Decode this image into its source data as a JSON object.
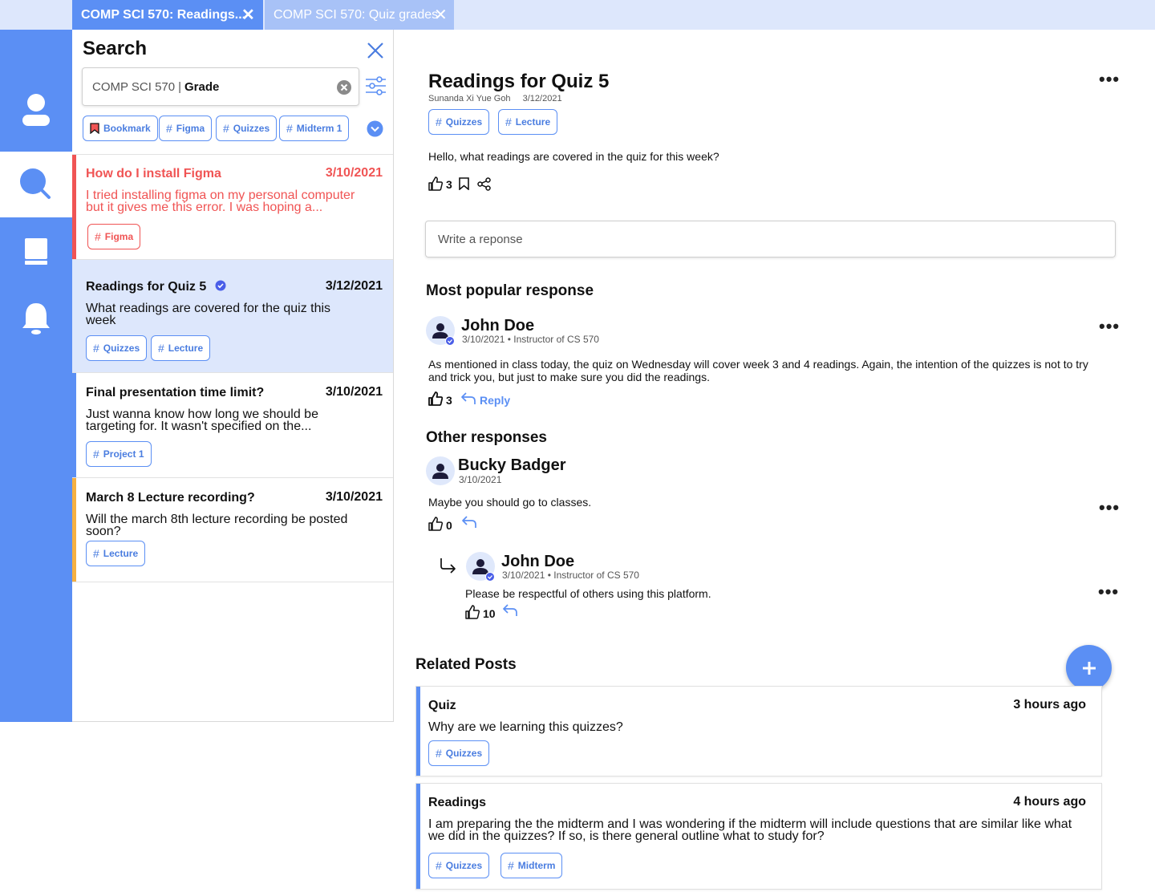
{
  "tabs": [
    {
      "label": "COMP SCI 570: Readings..."
    },
    {
      "label": "COMP SCI 570: Quiz grades"
    }
  ],
  "search": {
    "title": "Search",
    "query_prefix": "COMP SCI 570",
    "query_sep": "|",
    "query_term": "Grade",
    "filters": [
      "Bookmark",
      "Figma",
      "Quizzes",
      "Midterm 1"
    ]
  },
  "posts": [
    {
      "title": "How do I install Figma",
      "date": "3/10/2021",
      "body": "I tried installing figma on my personal computer but it gives me this error. I was hoping a...",
      "tags": [
        "Figma"
      ],
      "bar_color": "#f05454"
    },
    {
      "title": "Readings for Quiz 5",
      "date": "3/12/2021",
      "body": "What readings are covered for the quiz this week",
      "tags": [
        "Quizzes",
        "Lecture"
      ],
      "bar_color": "#dde7fc"
    },
    {
      "title": "Final presentation time limit?",
      "date": "3/10/2021",
      "body": "Just wanna know how long we should be targeting for. It wasn't specified on the...",
      "tags": [
        "Project 1"
      ],
      "bar_color": "#5b8ff4"
    },
    {
      "title": "March 8 Lecture recording?",
      "date": "3/10/2021",
      "body": "Will the march 8th lecture recording be posted soon?",
      "tags": [
        "Lecture"
      ],
      "bar_color": "#f5b042"
    }
  ],
  "thread": {
    "title": "Readings for Quiz 5",
    "author": "Sunanda Xi Yue Goh",
    "date": "3/12/2021",
    "tags": [
      "Quizzes",
      "Lecture"
    ],
    "body": "Hello, what readings are covered in the quiz for this week?",
    "likes": "3",
    "response_placeholder": "Write a reponse"
  },
  "popular": {
    "heading": "Most popular response",
    "name": "John Doe",
    "meta": "3/10/2021 • Instructor of CS 570",
    "body": "As mentioned in class today, the quiz on Wednesday will cover week 3 and 4 readings. Again, the intention of the quizzes is not to try and trick you, but just to make sure you did the readings.",
    "likes": "3",
    "reply_label": "Reply"
  },
  "other": {
    "heading": "Other responses",
    "name": "Bucky Badger",
    "date": "3/10/2021",
    "body": "Maybe you should go to classes.",
    "likes": "0",
    "reply": {
      "name": "John Doe",
      "meta": "3/10/2021 • Instructor of CS 570",
      "body": "Please be respectful of others using this platform.",
      "likes": "10"
    }
  },
  "related": {
    "heading": "Related Posts",
    "items": [
      {
        "title": "Quiz",
        "time": "3 hours ago",
        "body": "Why are we learning this quizzes?",
        "tags": [
          "Quizzes"
        ]
      },
      {
        "title": "Readings",
        "time": "4 hours ago",
        "body": "I am preparing the the midterm and I was wondering if the midterm will include questions that are similar like what we did in the quizzes? If so, is there general outline what to study for?",
        "tags": [
          "Quizzes",
          "Midterm"
        ]
      }
    ]
  },
  "colors": {
    "accent": "#5b8ff4",
    "danger": "#f05454",
    "warning": "#f5b042",
    "selected": "#dde7fc"
  },
  "icons": [
    "close-icon",
    "profile-icon",
    "search-icon",
    "book-icon",
    "bell-icon",
    "filter-sliders-icon",
    "clear-icon",
    "chevron-down-icon",
    "verified-icon",
    "thumbs-up-icon",
    "bookmark-icon",
    "share-icon",
    "reply-icon",
    "plus-icon",
    "hash-icon"
  ]
}
